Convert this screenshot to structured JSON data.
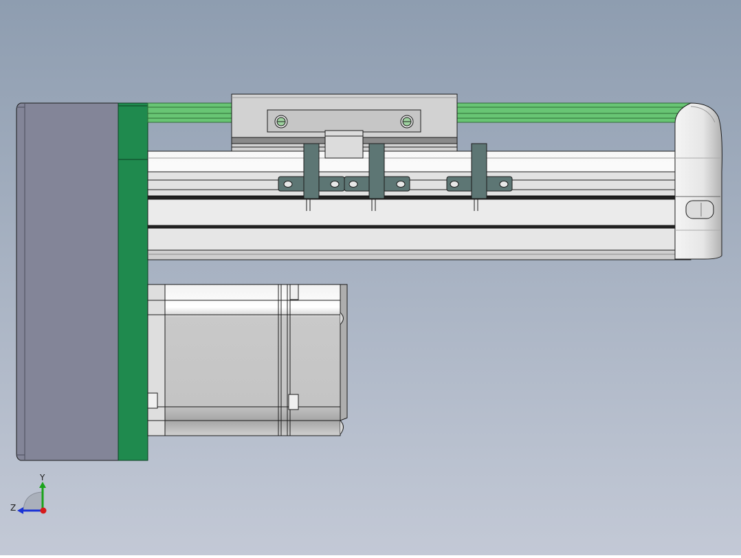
{
  "viewport": {
    "background_top": "#8e9db0",
    "background_bottom": "#c3c9d6"
  },
  "model": {
    "colors": {
      "cover_plate": "#838598",
      "mount_plate": "#1f8a4e",
      "belt_strip": "#68c574",
      "profile_body": "#d7d7d7",
      "bracket": "#5d7674",
      "motor_body": "#cbcbcb",
      "end_cap": "#eeeeee",
      "edge": "#1a1a1a"
    },
    "parts": [
      "cover-plate",
      "mount-plate",
      "belt-strip",
      "linear-module-profile",
      "carriage",
      "sensor-brackets",
      "end-cap",
      "stepper-motor"
    ]
  },
  "triad": {
    "y_label": "Y",
    "z_label": "Z",
    "y_color": "#1aa31a",
    "z_color": "#1a33d6",
    "x_color": "#d61a1a"
  }
}
